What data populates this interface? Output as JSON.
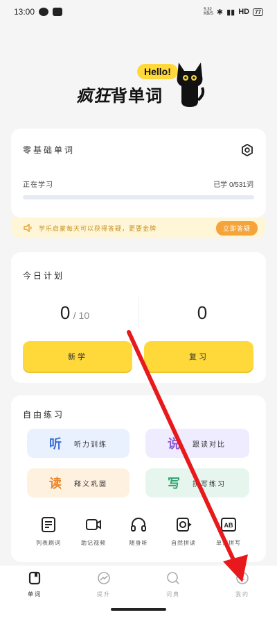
{
  "status_bar": {
    "time": "13:00",
    "network_speed": "5.32\nKB/S",
    "hd": "HD",
    "battery": "77"
  },
  "logo": {
    "bubble": "Hello!",
    "prefix": "疯狂",
    "suffix": "背单词"
  },
  "course": {
    "title": "零基础单词",
    "studying_label": "正在学习",
    "learned_label": "已学 0/531词",
    "progress_fraction": 0.0
  },
  "notice": {
    "text": "学乐启蒙每天可以获得答疑，更要金牌",
    "button": "立即答疑"
  },
  "plan": {
    "title": "今日计划",
    "new_count": "0",
    "new_total": "/ 10",
    "review_count": "0",
    "new_button": "新学",
    "review_button": "复习"
  },
  "practice": {
    "title": "自由练习",
    "tiles": [
      {
        "glyph": "听",
        "label": "听力训练"
      },
      {
        "glyph": "说",
        "label": "跟读对比"
      },
      {
        "glyph": "读",
        "label": "释义巩固"
      },
      {
        "glyph": "写",
        "label": "拼写练习"
      }
    ],
    "tools": [
      {
        "icon": "list-icon",
        "label": "列表刷词"
      },
      {
        "icon": "video-icon",
        "label": "助记视频"
      },
      {
        "icon": "headphones-icon",
        "label": "随身听"
      },
      {
        "icon": "natural-spelling-icon",
        "label": "自然拼读"
      },
      {
        "icon": "ab-icon",
        "label": "单词拼写"
      }
    ]
  },
  "tabs": [
    {
      "icon": "word-book-icon",
      "label": "单词",
      "active": true
    },
    {
      "icon": "trend-icon",
      "label": "提升",
      "active": false
    },
    {
      "icon": "dictionary-search-icon",
      "label": "词典",
      "active": false
    },
    {
      "icon": "profile-icon",
      "label": "我的",
      "active": false
    }
  ],
  "colors": {
    "accent_yellow": "#ffd83a",
    "progress": "#6c8be0",
    "notice_bg": "#fff6d8",
    "notice_button": "#f5a33b",
    "overlay_arrow": "#e8191d"
  }
}
